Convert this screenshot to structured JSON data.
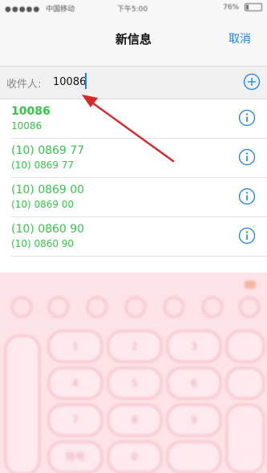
{
  "status_bar": {
    "carrier": "中国移动",
    "time": "下午5:00",
    "battery": "76%"
  },
  "nav": {
    "title": "新信息",
    "cancel_label": "取消"
  },
  "recipient": {
    "label": "收件人:",
    "value": "10086",
    "add_icon": "plus-circle-icon"
  },
  "suggestions": [
    {
      "primary": "10086",
      "secondary": "10086"
    },
    {
      "primary": "(10) 0869 77",
      "secondary": "(10) 0869 77"
    },
    {
      "primary": "(10) 0869 00",
      "secondary": "(10) 0869 00"
    },
    {
      "primary": "(10) 0860 90",
      "secondary": "(10) 0860 90"
    }
  ],
  "keyboard": {
    "keys_row1": [
      "1",
      "2",
      "3"
    ],
    "keys_row2": [
      "4",
      "5",
      "6"
    ],
    "keys_row3": [
      "7",
      "8",
      "9"
    ],
    "keys_row4": [
      "符号",
      "0"
    ]
  },
  "colors": {
    "accent_blue": "#1a82e2",
    "suggestion_green": "#3ac24d",
    "annotation_red": "#d9262b",
    "keyboard_pink": "#fde3e7"
  }
}
